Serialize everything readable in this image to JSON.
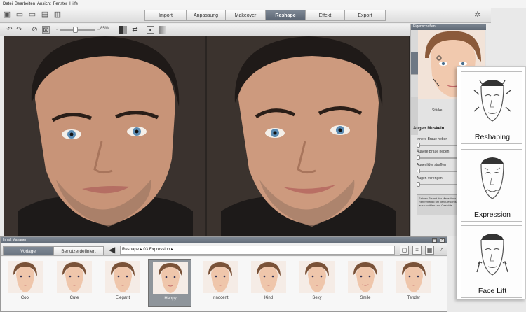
{
  "menu": [
    "Datei",
    "Bearbeiten",
    "Ansicht",
    "Fenster",
    "Hilfe"
  ],
  "tabs": [
    "Import",
    "Anpassung",
    "Makeover",
    "Reshape",
    "Effekt",
    "Export"
  ],
  "active_tab": "Reshape",
  "zoom": "85%",
  "right_panel": {
    "header": "Eigenschaften",
    "label_staerke": "Stärke",
    "section_title": "Augen Muskeln",
    "sliders": [
      "Innere Braue heben",
      "Äußere Braue heben",
      "Augenlider straffen",
      "Augen verengen"
    ],
    "info_text": "Fahren Sie mit der Maus über die Referenzbild um den Gesichts auszuwählen und Gesichts..."
  },
  "content_manager": {
    "title": "Inhalt Manager",
    "tabs": [
      "Vorlage",
      "Benutzerdefiniert"
    ],
    "path": "Reshape ▸ 03 Expression ▸",
    "presets": [
      "Cool",
      "Cute",
      "Elegant",
      "Happy",
      "Innocent",
      "Kind",
      "Sexy",
      "Smile",
      "Tender"
    ],
    "selected": "Happy"
  },
  "overlay_card": {
    "items": [
      "Reshaping",
      "Expression",
      "Face Lift"
    ]
  }
}
